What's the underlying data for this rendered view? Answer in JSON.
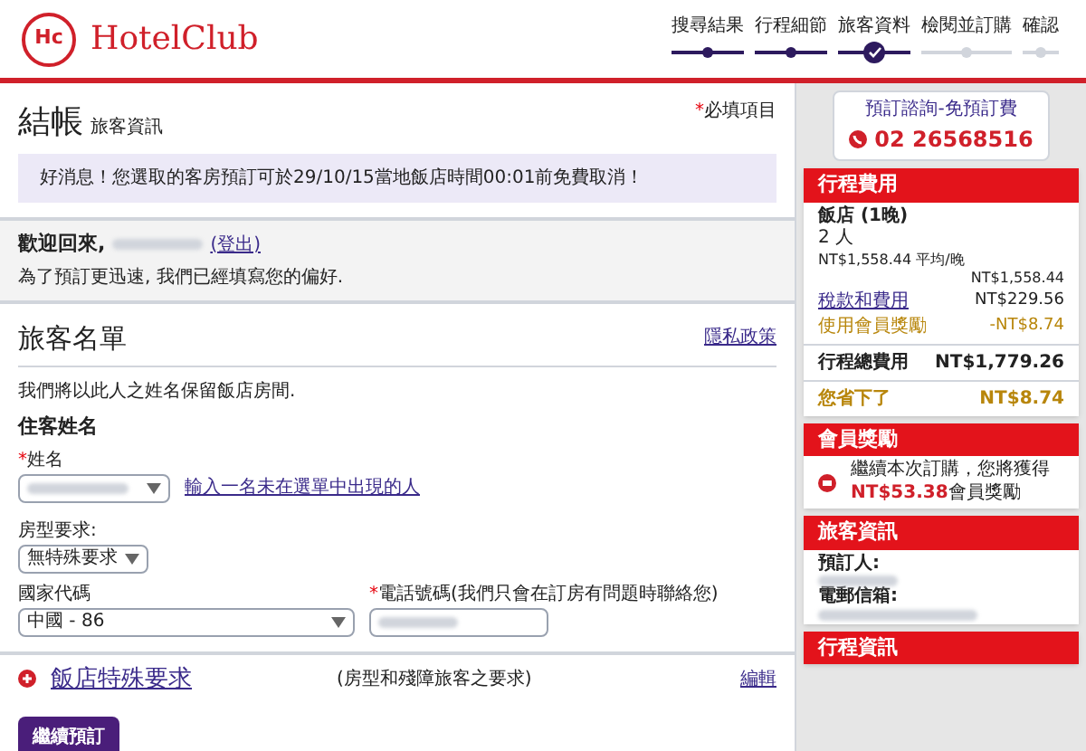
{
  "brand": {
    "logo": "Hc",
    "name": "HotelClub"
  },
  "steps": [
    {
      "label": "搜尋結果",
      "completed": true,
      "selected": false
    },
    {
      "label": "行程細節",
      "completed": true,
      "selected": false
    },
    {
      "label": "旅客資料",
      "completed": true,
      "selected": true
    },
    {
      "label": "檢閱並訂購",
      "completed": false,
      "selected": false
    },
    {
      "label": "確認",
      "completed": false,
      "selected": false
    }
  ],
  "heading": {
    "title": "結帳",
    "subtitle": "旅客資訊",
    "required_mark": "*",
    "required_note": "必填項目"
  },
  "notice": "好消息！您選取的客房預訂可於29/10/15當地飯店時間00:01前免費取消！",
  "welcome": {
    "greeting": "歡迎回來,",
    "logout": "(登出)",
    "note": "為了預訂更迅速, 我們已經填寫您的偏好."
  },
  "guests": {
    "title": "旅客名單",
    "privacy_link": "隱私政策",
    "intro": "我們將以此人之姓名保留飯店房間.",
    "section": "住客姓名",
    "name_field": {
      "mark": "*",
      "label": "姓名",
      "link": "輸入一名未在選單中出現的人"
    },
    "room_field": {
      "label": "房型要求:",
      "value": "無特殊要求"
    },
    "country_field": {
      "label": "國家代碼",
      "value": "中國 - 86"
    },
    "phone_field": {
      "mark": "*",
      "label": "電話號碼(我們只會在訂房有問題時聯絡您)"
    }
  },
  "special": {
    "title": "飯店特殊要求",
    "note": "(房型和殘障旅客之要求)",
    "edit": "編輯"
  },
  "continue_button": "繼續預訂",
  "call_box": {
    "title": "預訂諮詢-免預訂費",
    "phone": "02 26568516"
  },
  "cost": {
    "title": "行程費用",
    "hotel": "飯店 (1晚)",
    "guests": "2 人",
    "average": "NT$1,558.44 平均/晚",
    "average_amount": "NT$1,558.44",
    "rows": [
      {
        "kind": "link",
        "label": "稅款和費用",
        "amount": "NT$229.56"
      },
      {
        "kind": "discount",
        "label": "使用會員獎勵",
        "amount": "-NT$8.74"
      }
    ],
    "total_label": "行程總費用",
    "total": "NT$1,779.26",
    "saved_label": "您省下了",
    "saved": "NT$8.74"
  },
  "rewards": {
    "title": "會員獎勵",
    "text": "繼續本次訂購，您將獲得",
    "amount": "NT$53.38",
    "suffix": "會員獎勵"
  },
  "traveler": {
    "title": "旅客資訊",
    "booker_label": "預訂人:",
    "email_label": "電郵信箱:"
  },
  "itinerary": {
    "title": "行程資訊"
  }
}
